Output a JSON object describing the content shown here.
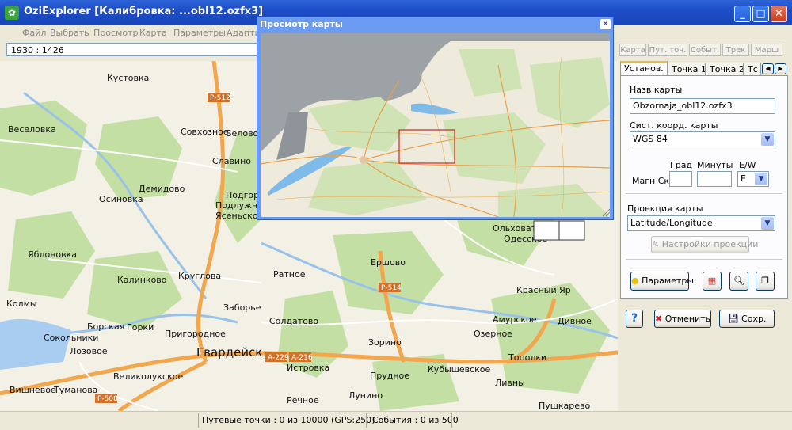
{
  "window": {
    "title": "OziExplorer [Калибровка: ...obl12.ozfx3]",
    "minimize_label": "_",
    "maximize_label": "□",
    "close_label": "✕"
  },
  "menu": [
    "Файл",
    "Выбрать",
    "Просмотр",
    "Карта",
    "Параметры",
    "Адапти..."
  ],
  "toolbar": {
    "scale": "1930 : 1426",
    "buttons": [
      "Карта",
      "Пут. точ.",
      "Событ.",
      "Трек",
      "Марш"
    ],
    "nav_left": "◀",
    "nav_right": "▶"
  },
  "panel": {
    "tabs": [
      "Установ.",
      "Точка 1",
      "Точка 2",
      "Тс"
    ],
    "map_name_label": "Назв карты",
    "map_name_value": "Obzornaja_obl12.ozfx3",
    "coord_sys_label": "Сист. коорд. карты",
    "coord_sys_value": "WGS 84",
    "deg_label": "Град",
    "min_label": "Минуты",
    "ew_label": "E/W",
    "mag_label": "Магн Скл",
    "ew_value": "E",
    "projection_label": "Проекция карты",
    "projection_value": "Latitude/Longitude",
    "projection_settings": "Настройки проекции",
    "params_button": "Параметры",
    "help_label": "?",
    "cancel_label": "Отменить",
    "save_label": "Сохр."
  },
  "status": {
    "waypoints": "Путевые точки : 0 из 10000  (GPS:250)",
    "events": "События : 0 из 500"
  },
  "popup": {
    "title": "Просмотр карты",
    "close_label": "✕"
  },
  "map_labels": [
    "Кустовка",
    "Веселовка",
    "Совхозное",
    "Белово",
    "Славино",
    "Демидово",
    "Осиновка",
    "Подгорное",
    "Подлужное",
    "Ясеньское",
    "Яблоновка",
    "Калинково",
    "Круглова",
    "Ратное",
    "Ершово",
    "Ольховатка",
    "Одесское",
    "Колмы",
    "Заборье",
    "Борская",
    "Сокольники",
    "Лозовое",
    "Горки",
    "Пригородное",
    "Гвардейск",
    "Солдатово",
    "Зорино",
    "Красный Яр",
    "Амурское",
    "Дивное",
    "Озерное",
    "Истровка",
    "Кубышевское",
    "Тополки",
    "Великолукское",
    "Прудное",
    "Лунино",
    "Вишневое",
    "Туманова",
    "Речное",
    "Пушкарево",
    "Ливны"
  ],
  "road_labels": [
    "Р-512",
    "Р-514",
    "А-229",
    "А-216",
    "Р-508"
  ]
}
